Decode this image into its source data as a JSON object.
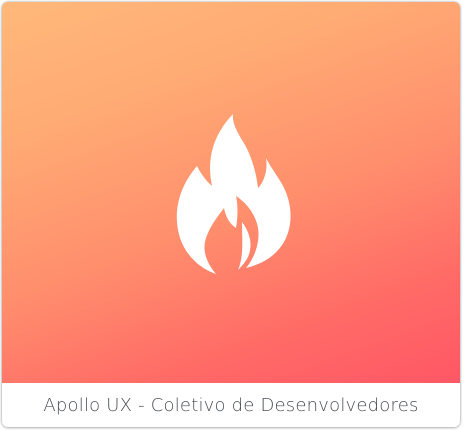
{
  "hero": {
    "icon": "flame-icon",
    "gradient_colors": [
      "#ffb87a",
      "#ff8e6d",
      "#ff5766"
    ],
    "icon_color": "#ffffff"
  },
  "footer": {
    "caption": "Apollo UX - Coletivo de Desenvolvedores"
  }
}
